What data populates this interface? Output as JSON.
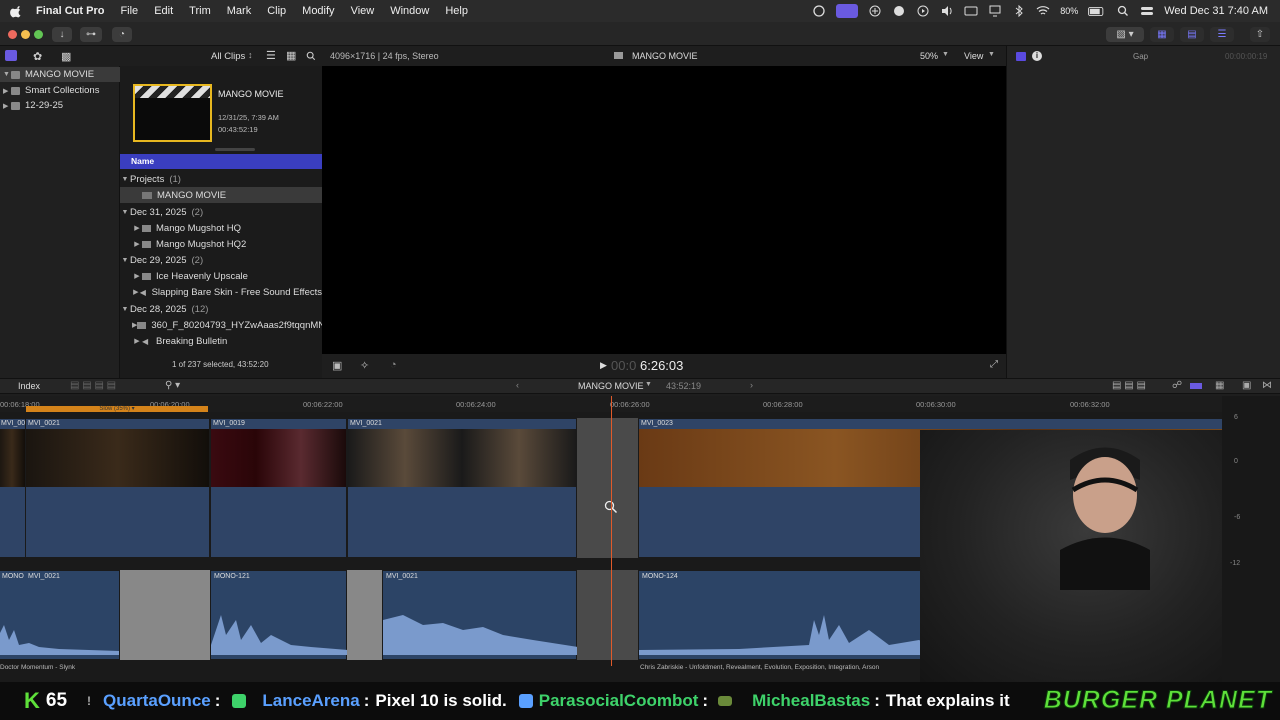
{
  "menubar": {
    "app": "Final Cut Pro",
    "items": [
      "File",
      "Edit",
      "Trim",
      "Mark",
      "Clip",
      "Modify",
      "View",
      "Window",
      "Help"
    ],
    "battery": "80%",
    "datetime": "Wed Dec 31  7:40 AM"
  },
  "browser_bar": {
    "clips_filter": "All Clips"
  },
  "library": {
    "items": [
      {
        "label": "MANGO MOVIE",
        "selected": true
      },
      {
        "label": "Smart Collections"
      },
      {
        "label": "12-29-25"
      }
    ]
  },
  "project_thumb": {
    "title": "MANGO MOVIE",
    "date": "12/31/25, 7:39 AM",
    "duration": "00:43:52:19"
  },
  "browser": {
    "col_name": "Name",
    "groups": [
      {
        "label": "Projects",
        "count": "(1)"
      },
      {
        "label": "Dec 31, 2025",
        "count": "(2)"
      },
      {
        "label": "Dec 29, 2025",
        "count": "(2)"
      },
      {
        "label": "Dec 28, 2025",
        "count": "(12)"
      }
    ],
    "rows": [
      "MANGO MOVIE",
      "Mango Mugshot HQ",
      "Mango Mugshot HQ2",
      "Ice Heavenly Upscale",
      "Slapping Bare Skin - Free Sound Effects",
      "360_F_80204793_HYZwAaas2f9tqqnMN",
      "Breaking Bulletin"
    ],
    "status": "1 of 237 selected, 43:52:20"
  },
  "viewer": {
    "format": "4096×1716 | 24 fps, Stereo",
    "title": "MANGO MOVIE",
    "zoom": "50%",
    "view_label": "View",
    "timecode": "6:26:03",
    "timecode_prefix": "00:0"
  },
  "inspector": {
    "label": "Gap",
    "timecode": "00:00:00:19"
  },
  "timeline_bar": {
    "index": "Index",
    "project": "MANGO MOVIE",
    "duration": "43:52:19"
  },
  "ruler": [
    "00:06:18:00",
    "00:06:20:00",
    "00:06:22:00",
    "00:06:24:00",
    "00:06:26:00",
    "00:06:28:00",
    "00:06:30:00",
    "00:06:32:00"
  ],
  "retime": "Slow (35%) ▾",
  "video_clips": [
    "MVI_0021",
    "MVI_0021",
    "MVI_0019",
    "MVI_0021",
    "MVI_0023"
  ],
  "audio_clips": [
    "MONO",
    "MVI_0021",
    "MONO-121",
    "MVI_0021",
    "MONO-124"
  ],
  "audio_captions": [
    "Doctor Momentum - Slynk",
    "Chris Zabriskie - Unfoldment, Revealment, Evolution, Exposition, Integration, Arson"
  ],
  "meters": [
    "6",
    "0",
    "-6",
    "-12"
  ],
  "ticker": {
    "k_count": "65",
    "messages": [
      {
        "user": "QuartaOunce",
        "text": ""
      },
      {
        "user": "LanceArena",
        "text": "Pixel 10 is solid."
      },
      {
        "user": "ParasocialCoombot",
        "text": ""
      },
      {
        "user": "MichealBastas",
        "text": "That explains it"
      }
    ],
    "brand": "BURGER PLANET"
  },
  "colors": {
    "accent": "#3a3ec0",
    "selection": "#e8b820",
    "playhead": "#e05a2a",
    "retime": "#d4831a",
    "ticker_user": "#5aa0ff",
    "ticker_user2": "#3ed26a",
    "brand": "#5ee03a"
  }
}
